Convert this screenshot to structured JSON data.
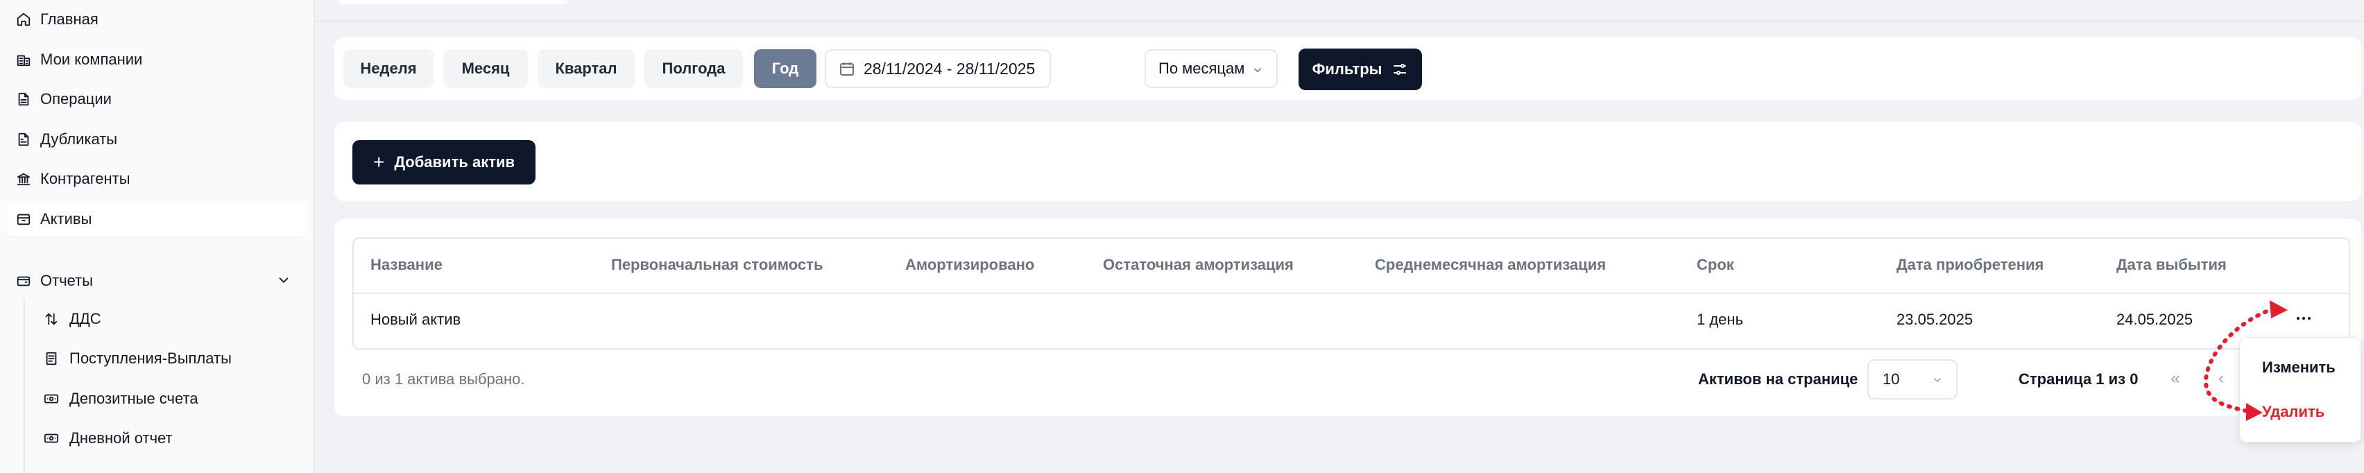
{
  "sidebar": {
    "items": [
      {
        "label": "Главная",
        "icon": "home-icon"
      },
      {
        "label": "Мои компании",
        "icon": "buildings-icon"
      },
      {
        "label": "Операции",
        "icon": "document-icon"
      },
      {
        "label": "Дубликаты",
        "icon": "copy-document-icon"
      },
      {
        "label": "Контрагенты",
        "icon": "bank-icon"
      },
      {
        "label": "Активы",
        "icon": "archive-box-icon",
        "active": true
      }
    ],
    "reports": {
      "label": "Отчеты",
      "icon": "wallet-icon",
      "sub_items": [
        {
          "label": "ДДС",
          "icon": "arrows-up-down-icon"
        },
        {
          "label": "Поступления-Выплаты",
          "icon": "receipt-icon"
        },
        {
          "label": "Депозитные счета",
          "icon": "banknote-icon"
        },
        {
          "label": "Дневной отчет",
          "icon": "banknote-icon"
        }
      ]
    }
  },
  "filters": {
    "periods": [
      "Неделя",
      "Месяц",
      "Квартал",
      "Полгода",
      "Год"
    ],
    "selected_period": "Год",
    "date_range": "28/11/2024 - 28/11/2025",
    "grouping": "По месяцам",
    "filters_label": "Фильтры"
  },
  "actions": {
    "add_asset_label": "Добавить актив"
  },
  "table": {
    "columns": [
      "Название",
      "Первоначальная стоимость",
      "Амортизировано",
      "Остаточная амортизация",
      "Среднемесячная амортизация",
      "Срок",
      "Дата приобретения",
      "Дата выбытия"
    ],
    "rows": [
      {
        "name": "Новый актив",
        "initial_cost": "",
        "amortized": "",
        "residual": "",
        "monthly": "",
        "term": "1 день",
        "purchase_date": "23.05.2025",
        "disposal_date": "24.05.2025"
      }
    ]
  },
  "pagination": {
    "selected_info": "0 из 1 актива выбрано.",
    "per_page_label": "Активов на странице",
    "per_page_value": "10",
    "page_info": "Страница 1 из 0",
    "first_symbol": "«",
    "prev_symbol": "‹"
  },
  "context_menu": {
    "edit": "Изменить",
    "delete": "Удалить"
  },
  "colors": {
    "primary_dark": "#0f172a",
    "selected_period": "#6b7b93",
    "danger": "#dc2626",
    "annotation": "#e11d2e"
  }
}
